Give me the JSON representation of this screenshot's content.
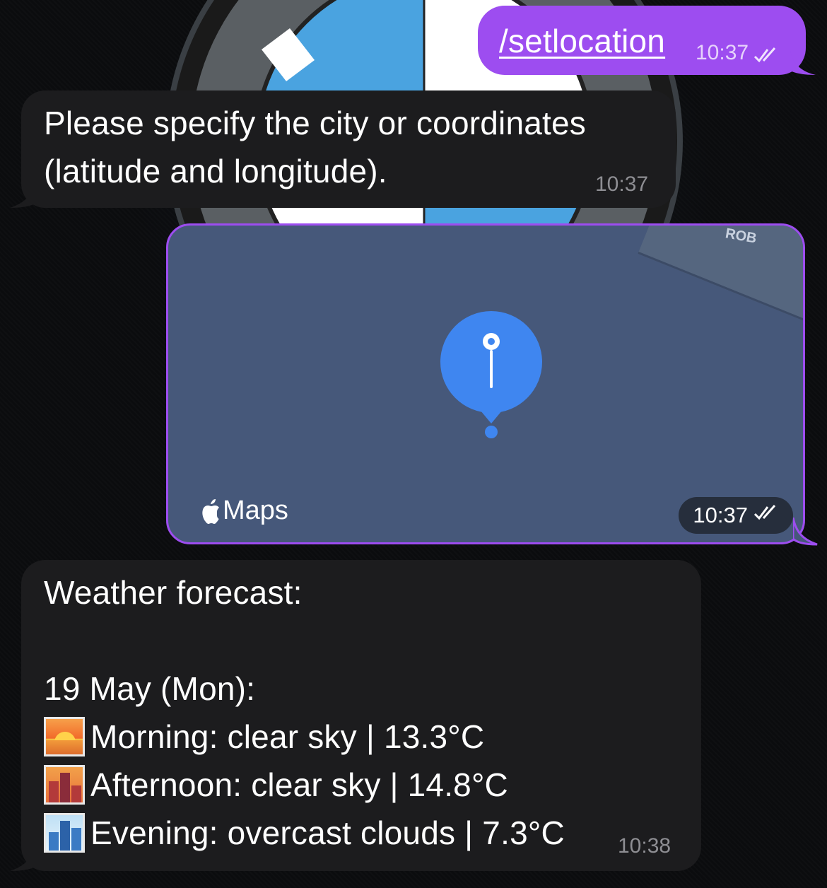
{
  "messages": {
    "command": {
      "text": "/setlocation",
      "time": "10:37"
    },
    "prompt": {
      "line1": "Please specify the city or coordinates",
      "line2": "(latitude and longitude).",
      "time": "10:37"
    },
    "location": {
      "brand": "Maps",
      "road_label": "ROB",
      "time": "10:37"
    },
    "forecast": {
      "title": "Weather forecast:",
      "date": "19 May (Mon):",
      "morning": "Morning: clear sky | 13.3°C",
      "afternoon": "Afternoon: clear sky | 14.8°C",
      "evening": "Evening: overcast clouds | 7.3°C",
      "time": "10:38"
    }
  },
  "icons": {
    "read_receipt": "double-check-icon",
    "map_pin": "map-pin-icon",
    "apple_logo": "apple-icon",
    "morning": "sunrise-emoji-icon",
    "afternoon": "city-sunset-emoji-icon",
    "evening": "cityscape-emoji-icon"
  },
  "colors": {
    "outgoing_bubble": "#9d4df0",
    "incoming_bubble": "#1c1c1e",
    "map_background": "#46587a",
    "pin": "#3f86f0"
  }
}
